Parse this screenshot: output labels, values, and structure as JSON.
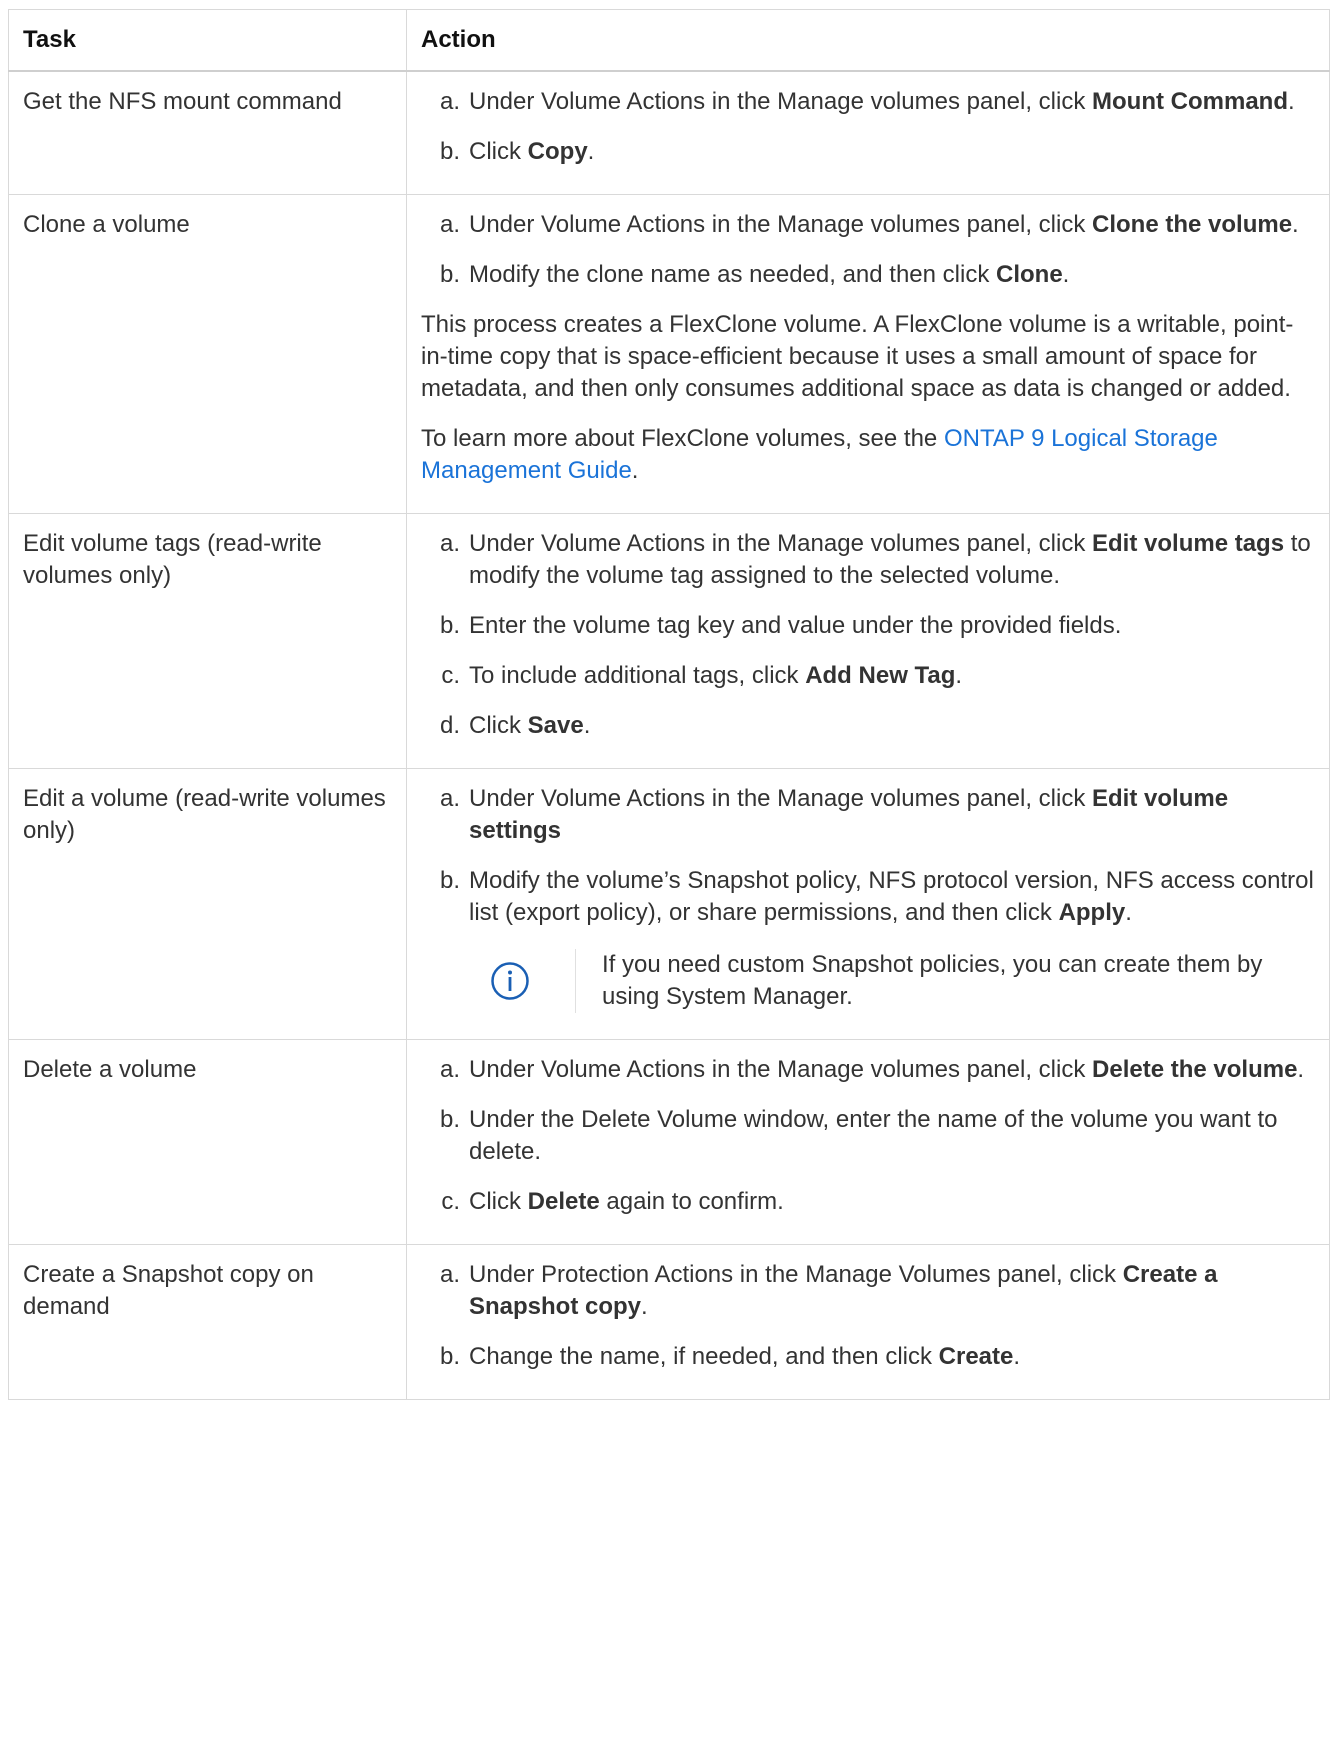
{
  "header": {
    "task": "Task",
    "action": "Action"
  },
  "rows": [
    {
      "task": "Get the NFS mount command",
      "steps": [
        {
          "letter": "a.",
          "pre": "Under Volume Actions in the Manage volumes panel, click ",
          "bold": "Mount Command",
          "post": "."
        },
        {
          "letter": "b.",
          "pre": "Click ",
          "bold": "Copy",
          "post": "."
        }
      ]
    },
    {
      "task": "Clone a volume",
      "steps": [
        {
          "letter": "a.",
          "pre": "Under Volume Actions in the Manage volumes panel, click ",
          "bold": "Clone the volume",
          "post": "."
        },
        {
          "letter": "b.",
          "pre": "Modify the clone name as needed, and then click ",
          "bold": "Clone",
          "post": "."
        }
      ],
      "para1": "This process creates a FlexClone volume. A FlexClone volume is a writable, point-in-time copy that is space-efficient because it uses a small amount of space for metadata, and then only consumes additional space as data is changed or added.",
      "para2_pre": "To learn more about FlexClone volumes, see the ",
      "para2_link": "ONTAP 9 Logical Storage Management Guide",
      "para2_post": "."
    },
    {
      "task": "Edit volume tags (read-write volumes only)",
      "steps": [
        {
          "letter": "a.",
          "pre": "Under Volume Actions in the Manage volumes panel, click ",
          "bold": "Edit volume tags",
          "post": " to modify the volume tag assigned to the selected volume."
        },
        {
          "letter": "b.",
          "pre": "Enter the volume tag key and value under the provided fields.",
          "bold": "",
          "post": ""
        },
        {
          "letter": "c.",
          "pre": "To include additional tags, click ",
          "bold": "Add New Tag",
          "post": "."
        },
        {
          "letter": "d.",
          "pre": "Click ",
          "bold": "Save",
          "post": "."
        }
      ]
    },
    {
      "task": "Edit a volume (read-write volumes only)",
      "steps": [
        {
          "letter": "a.",
          "pre": "Under Volume Actions in the Manage volumes panel, click ",
          "bold": "Edit volume settings",
          "post": ""
        },
        {
          "letter": "b.",
          "pre": "Modify the volume’s Snapshot policy, NFS protocol version, NFS access control list (export policy), or share permissions, and then click ",
          "bold": "Apply",
          "post": "."
        }
      ],
      "note": "If you need custom Snapshot policies, you can create them by using System Manager.",
      "note_icon": "info-icon"
    },
    {
      "task": "Delete a volume",
      "steps": [
        {
          "letter": "a.",
          "pre": "Under Volume Actions in the Manage volumes panel, click ",
          "bold": "Delete the volume",
          "post": "."
        },
        {
          "letter": "b.",
          "pre": "Under the Delete Volume window, enter the name of the volume you want to delete.",
          "bold": "",
          "post": ""
        },
        {
          "letter": "c.",
          "pre": "Click ",
          "bold": "Delete",
          "post": " again to confirm."
        }
      ]
    },
    {
      "task": "Create a Snapshot copy on demand",
      "steps": [
        {
          "letter": "a.",
          "pre": "Under Protection Actions in the Manage Volumes panel, click ",
          "bold": "Create a Snapshot copy",
          "post": "."
        },
        {
          "letter": "b.",
          "pre": "Change the name, if needed, and then click ",
          "bold": "Create",
          "post": "."
        }
      ]
    }
  ],
  "colors": {
    "link": "#1a73d8",
    "border": "#d9d9d9",
    "text": "#333333",
    "info_icon": "#1a5fb4"
  }
}
